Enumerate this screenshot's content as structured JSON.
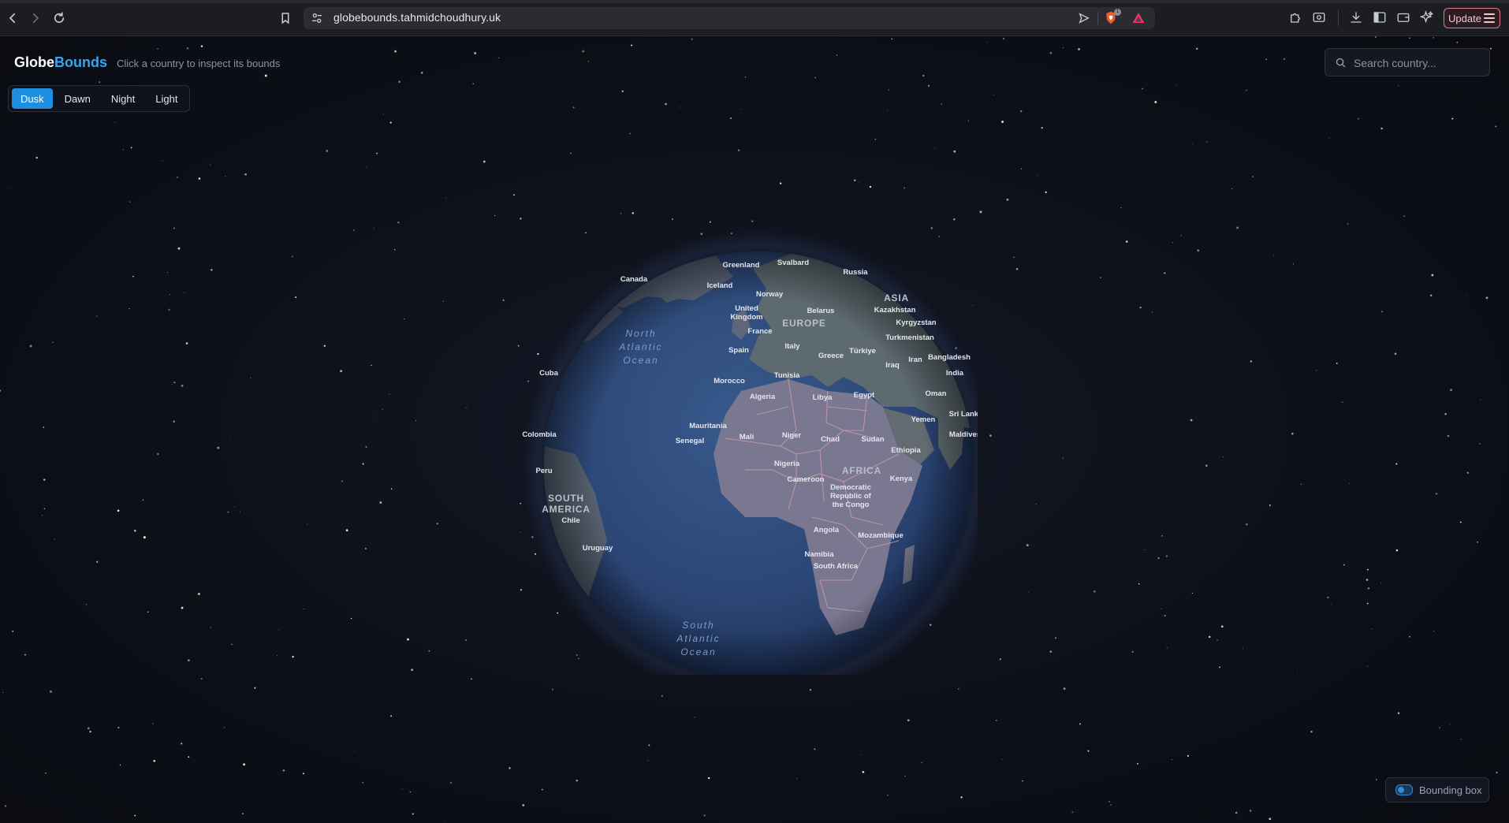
{
  "browser": {
    "url": "globebounds.tahmidchoudhury.uk",
    "update_label": "Update",
    "shield_badge": "1"
  },
  "app": {
    "brand_part1": "Globe",
    "brand_part2": "Bounds",
    "tagline": "Click a country to inspect its bounds",
    "themes": [
      "Dusk",
      "Dawn",
      "Night",
      "Light"
    ],
    "active_theme": "Dusk",
    "search_placeholder": "Search country...",
    "bbox_label": "Bounding box",
    "bbox_enabled": false
  },
  "map_labels": {
    "continents": [
      "ASIA",
      "EUROPE",
      "AFRICA",
      "SOUTH AMERICA"
    ],
    "oceans": [
      "North Atlantic Ocean",
      "South Atlantic Ocean"
    ],
    "countries": [
      "Greenland",
      "Svalbard",
      "Russia",
      "Canada",
      "Iceland",
      "Norway",
      "United Kingdom",
      "Belarus",
      "Kazakhstan",
      "France",
      "Kyrgyzstan",
      "Turkmenistan",
      "Spain",
      "Italy",
      "Greece",
      "Türkiye",
      "Iran",
      "Bangladesh",
      "Cuba",
      "Iraq",
      "India",
      "Tunisia",
      "Morocco",
      "Algeria",
      "Libya",
      "Egypt",
      "Oman",
      "Yemen",
      "Sri Lanka",
      "Mauritania",
      "Colombia",
      "Mali",
      "Niger",
      "Chad",
      "Sudan",
      "Maldives",
      "Senegal",
      "Ethiopia",
      "Nigeria",
      "Peru",
      "Cameroon",
      "Kenya",
      "Democratic Republic of the Congo",
      "Chile",
      "Angola",
      "Mozambique",
      "Uruguay",
      "Namibia",
      "South Africa"
    ]
  },
  "colors": {
    "accent": "#1e8fe0",
    "brand_blue": "#33a8f0",
    "background": "#0c0e14",
    "ocean": "#2c4a78",
    "land": "#5f6877",
    "africa_highlight": "#7d7a95",
    "border": "#c99aa8"
  }
}
